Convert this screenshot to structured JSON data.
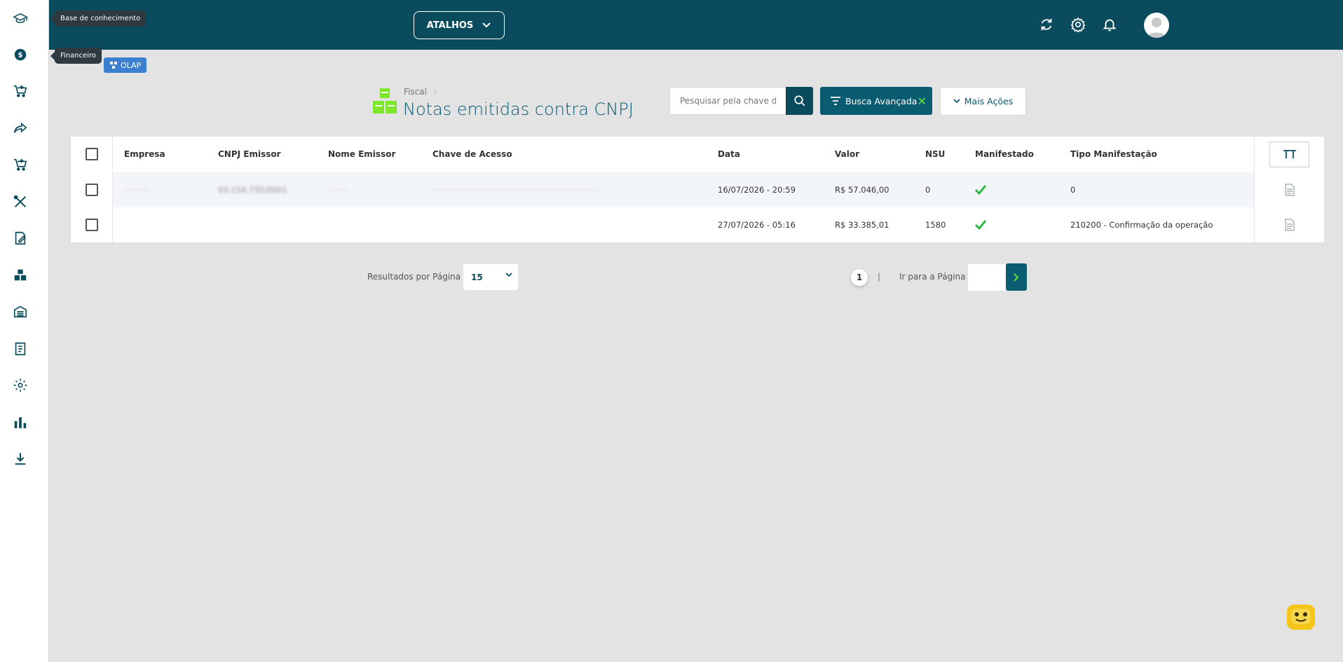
{
  "sidebar": {
    "tooltip_knowledge": "Base de conhecimento",
    "tooltip_financeiro": "Financeiro",
    "items": [
      "graduation-cap-icon",
      "dollar-icon",
      "cart-plus-icon",
      "share-arrow-icon",
      "cart-plus-icon",
      "tools-icon",
      "edit-note-icon",
      "boxes-icon",
      "warehouse-icon",
      "receipt-icon",
      "gear-icon",
      "chart-bars-icon",
      "download-icon"
    ]
  },
  "header": {
    "atalhos_label": "ATALHOS",
    "bg_color": "#0a4c5e"
  },
  "olap": {
    "label": "OLAP"
  },
  "page": {
    "breadcrumb": "Fiscal",
    "title": "Notas emitidas contra CNPJ"
  },
  "toolbar": {
    "search_placeholder": "Pesquisar pela chave de",
    "busca_label": "Busca Avançada",
    "mais_label": "Mais Ações"
  },
  "table": {
    "columns": {
      "empresa": "Empresa",
      "cnpj": "CNPJ Emissor",
      "nome": "Nome Emissor",
      "chave": "Chave de Acesso",
      "data": "Data",
      "valor": "Valor",
      "nsu": "NSU",
      "manifestado": "Manifestado",
      "tipo": "Tipo Manifestação"
    },
    "rows": [
      {
        "empresa": "··········",
        "cnpj": "03.154.735/0001",
        "nome": "········",
        "chave": "·································································",
        "data": "16/07/2026 - 20:59",
        "valor": "R$ 57.046,00",
        "nsu": "0",
        "tipo": "0"
      },
      {
        "empresa": "",
        "cnpj": "",
        "nome": "",
        "chave": "",
        "data": "27/07/2026 - 05:16",
        "valor": "R$ 33.385,01",
        "nsu": "1580",
        "tipo": "210200 - Confirmação da operação"
      }
    ]
  },
  "pagination": {
    "rpp_label": "Resultados por Página",
    "rpp_value": "15",
    "current_page": "1",
    "separator": "|",
    "goto_label": "Ir para a Página"
  }
}
